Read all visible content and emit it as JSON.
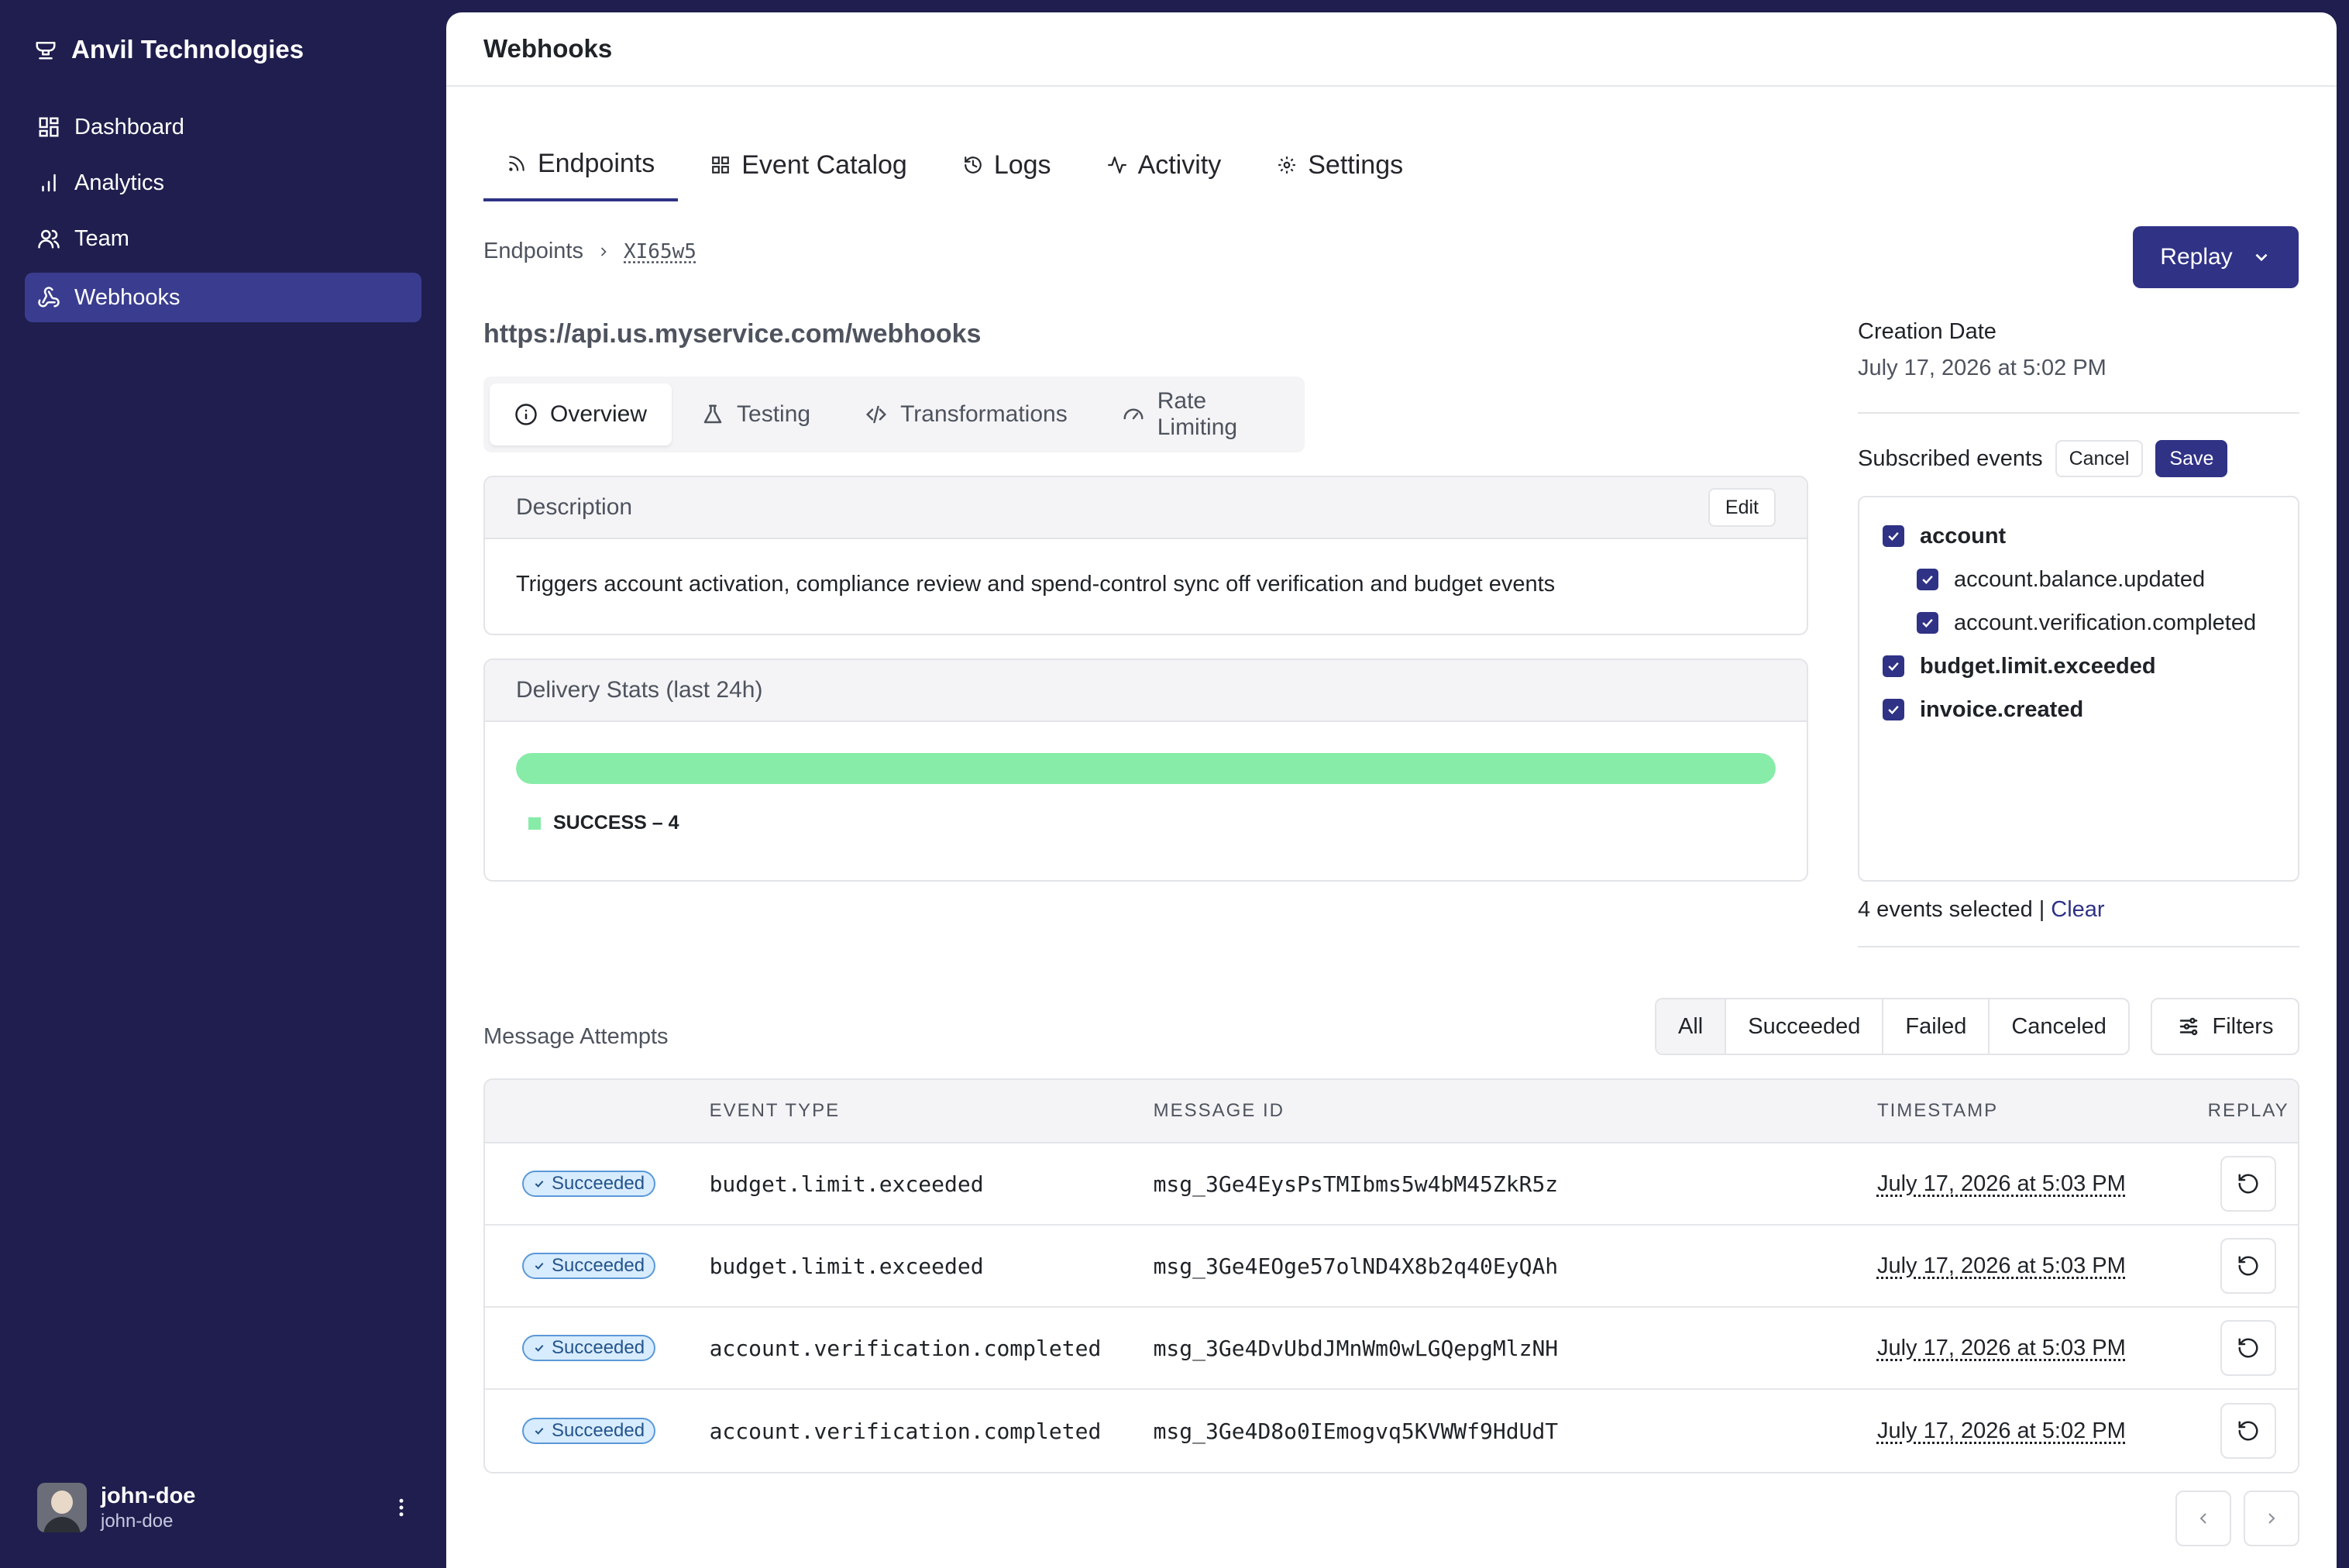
{
  "sidebar": {
    "brand": "Anvil Technologies",
    "items": [
      {
        "label": "Dashboard",
        "icon": "dashboard-icon"
      },
      {
        "label": "Analytics",
        "icon": "bar-chart-icon"
      },
      {
        "label": "Team",
        "icon": "users-icon"
      },
      {
        "label": "Webhooks",
        "icon": "webhook-icon",
        "active": true
      }
    ],
    "user": {
      "name": "john-doe",
      "handle": "john-doe"
    }
  },
  "header": {
    "title": "Webhooks"
  },
  "tabs": [
    {
      "label": "Endpoints",
      "icon": "rss-icon",
      "active": true
    },
    {
      "label": "Event Catalog",
      "icon": "grid-icon"
    },
    {
      "label": "Logs",
      "icon": "history-icon"
    },
    {
      "label": "Activity",
      "icon": "activity-icon"
    },
    {
      "label": "Settings",
      "icon": "gear-icon"
    }
  ],
  "breadcrumb": {
    "parent": "Endpoints",
    "current": "XI65w5"
  },
  "replay_button": "Replay",
  "endpoint": {
    "url": "https://api.us.myservice.com/webhooks",
    "subtabs": [
      {
        "label": "Overview",
        "icon": "info-icon",
        "active": true
      },
      {
        "label": "Testing",
        "icon": "flask-icon"
      },
      {
        "label": "Transformations",
        "icon": "code-icon"
      },
      {
        "label": "Rate Limiting",
        "icon": "gauge-icon"
      }
    ],
    "description": {
      "title": "Description",
      "edit_label": "Edit",
      "text": "Triggers account activation, compliance review and spend-control sync off verification and budget events"
    },
    "stats": {
      "title": "Delivery Stats (last 24h)",
      "success_fraction": 1.0,
      "legend": "SUCCESS – 4",
      "color": "#87eca8"
    }
  },
  "details": {
    "creation_label": "Creation Date",
    "creation_value": "July 17, 2026 at 5:02 PM",
    "subscribed_label": "Subscribed events",
    "cancel_label": "Cancel",
    "save_label": "Save",
    "events": [
      {
        "name": "account",
        "level": 0,
        "checked": true
      },
      {
        "name": "account.balance.updated",
        "level": 1,
        "checked": true
      },
      {
        "name": "account.verification.completed",
        "level": 1,
        "checked": true
      },
      {
        "name": "budget.limit.exceeded",
        "level": 0,
        "checked": true
      },
      {
        "name": "invoice.created",
        "level": 0,
        "checked": true
      }
    ],
    "selected_count": "4 events selected",
    "separator": "|",
    "clear_label": "Clear"
  },
  "attempts": {
    "title": "Message Attempts",
    "filters": [
      "All",
      "Succeeded",
      "Failed",
      "Canceled"
    ],
    "active_filter": "All",
    "filters_button": "Filters",
    "columns": {
      "event_type": "EVENT TYPE",
      "message_id": "MESSAGE ID",
      "timestamp": "TIMESTAMP",
      "replay": "REPLAY"
    },
    "rows": [
      {
        "status": "Succeeded",
        "event_type": "budget.limit.exceeded",
        "message_id": "msg_3Ge4EysPsTMIbms5w4bM45ZkR5z",
        "timestamp": "July 17, 2026 at 5:03 PM"
      },
      {
        "status": "Succeeded",
        "event_type": "budget.limit.exceeded",
        "message_id": "msg_3Ge4EOge57olND4X8b2q40EyQAh",
        "timestamp": "July 17, 2026 at 5:03 PM"
      },
      {
        "status": "Succeeded",
        "event_type": "account.verification.completed",
        "message_id": "msg_3Ge4DvUbdJMnWm0wLGQepgMlzNH",
        "timestamp": "July 17, 2026 at 5:03 PM"
      },
      {
        "status": "Succeeded",
        "event_type": "account.verification.completed",
        "message_id": "msg_3Ge4D8o0IEmogvq5KVWWf9HdUdT",
        "timestamp": "July 17, 2026 at 5:02 PM"
      }
    ]
  },
  "colors": {
    "sidebar_bg": "#1f1e4e",
    "accent": "#2f3285",
    "active_nav": "#3a3d8f",
    "success": "#87eca8",
    "badge_bg": "#d8ecff"
  }
}
